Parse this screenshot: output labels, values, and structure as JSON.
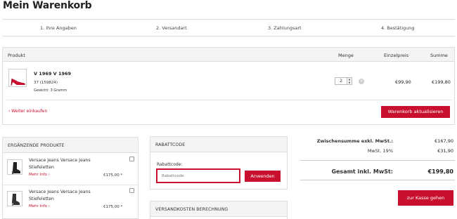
{
  "page": {
    "title": "Mein Warenkorb"
  },
  "steps": [
    "1. Ihre Angaben",
    "2. Versandart",
    "3. Zahlungsart",
    "4. Bestätigung"
  ],
  "cart": {
    "headers": {
      "product": "Produkt",
      "qty": "Menge",
      "unit": "Einzelpreis",
      "sum": "Summe"
    },
    "item": {
      "name": "V 1969 V 1969",
      "variant": "37 (159824)",
      "weight": "Gewicht: 3 Gramm",
      "qty": "2",
      "unit_price": "€99,90",
      "total": "€199,80"
    },
    "continue_link": "‹ Weiter einkaufen",
    "update_button": "Warenkorb aktualisieren"
  },
  "cross": {
    "title": "ERGÄNZENDE PRODUKTE",
    "items": [
      {
        "name": "Versace Jeans Versace Jeans Stiefeletten",
        "info": "Mehr Info ›",
        "price": "€175,00 *"
      },
      {
        "name": "Versace Jeans Versace Jeans Stiefeletten",
        "info": "Mehr Info ›",
        "price": "€175,00 *"
      }
    ]
  },
  "coupon": {
    "title": "RABATTCODE",
    "label": "Rabattcode:",
    "placeholder": "Rabattcode",
    "button": "Anwenden"
  },
  "shipping": {
    "title": "VERSANDKOSTEN BERECHNUNG"
  },
  "summary": {
    "subtotal_label": "Zwischensumme exkl. MwSt.:",
    "subtotal_value": "€167,90",
    "tax_label": "MwSt. 19%",
    "tax_value": "€31,90",
    "total_label": "Gesamt inkl. MwSt:",
    "total_value": "€199,80",
    "checkout_button": "zur Kasse gehen"
  },
  "colors": {
    "accent": "#c8102e"
  },
  "icons": {
    "delete": "close-circle-icon",
    "spin": "spinner-arrows-icon",
    "product": "red-pump-shoe-image",
    "cross_product": "black-ankle-boot-image"
  }
}
